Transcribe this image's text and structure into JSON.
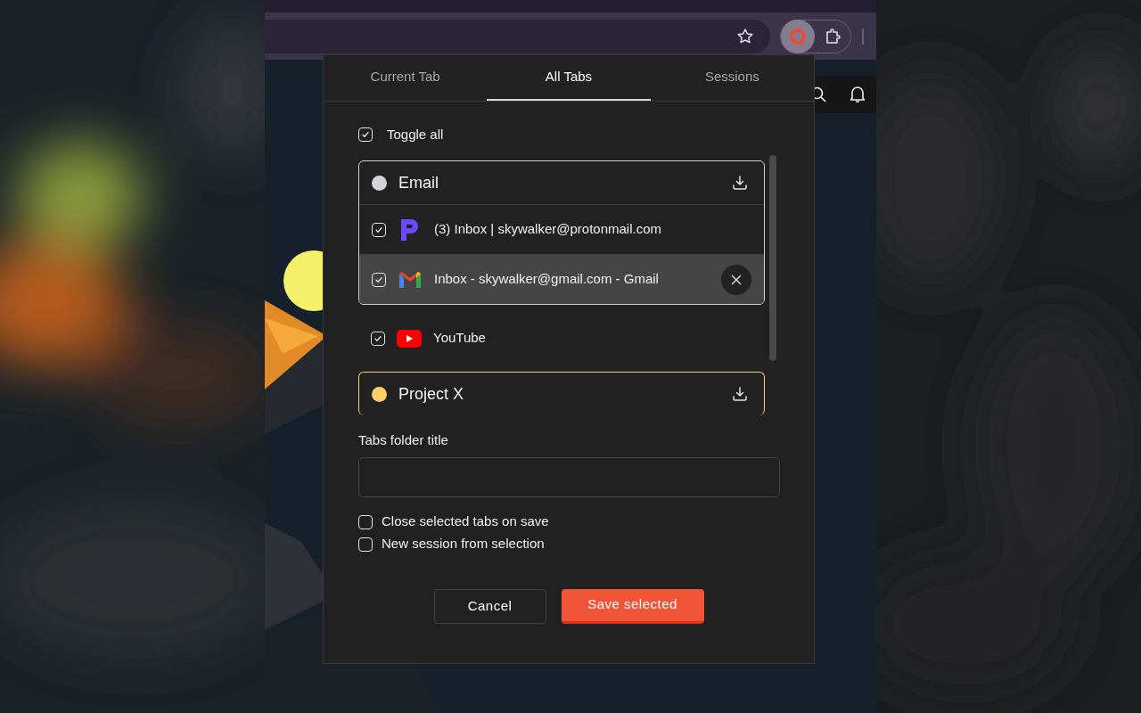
{
  "tabs": [
    {
      "label": "Current Tab",
      "selected": false
    },
    {
      "label": "All Tabs",
      "selected": true
    },
    {
      "label": "Sessions",
      "selected": false
    }
  ],
  "toggle_all": {
    "label": "Toggle all",
    "checked": true
  },
  "list": [
    {
      "kind": "group",
      "title": "Email",
      "color": "#d4d4d8",
      "children": [
        {
          "title": "(3) Inbox | skywalker@protonmail.com",
          "favicon": {
            "kind": "proton"
          },
          "checked": true,
          "highlighted": false
        },
        {
          "title": "Inbox - skywalker@gmail.com - Gmail",
          "favicon": {
            "kind": "gmail"
          },
          "checked": true,
          "highlighted": true
        }
      ]
    },
    {
      "kind": "tab",
      "title": "YouTube",
      "favicon": {
        "kind": "youtube"
      },
      "checked": true,
      "highlighted": false
    },
    {
      "kind": "group",
      "title": "Project X",
      "color": "#fcd068"
    }
  ],
  "folder_field": {
    "label": "Tabs folder title"
  },
  "options": [
    {
      "label": "Close selected tabs on save",
      "checked": false
    },
    {
      "label": "New session from selection",
      "checked": false
    }
  ],
  "buttons": [
    {
      "label": "Cancel",
      "kind": "secondary"
    },
    {
      "label": "Save selected",
      "kind": "primary"
    }
  ]
}
